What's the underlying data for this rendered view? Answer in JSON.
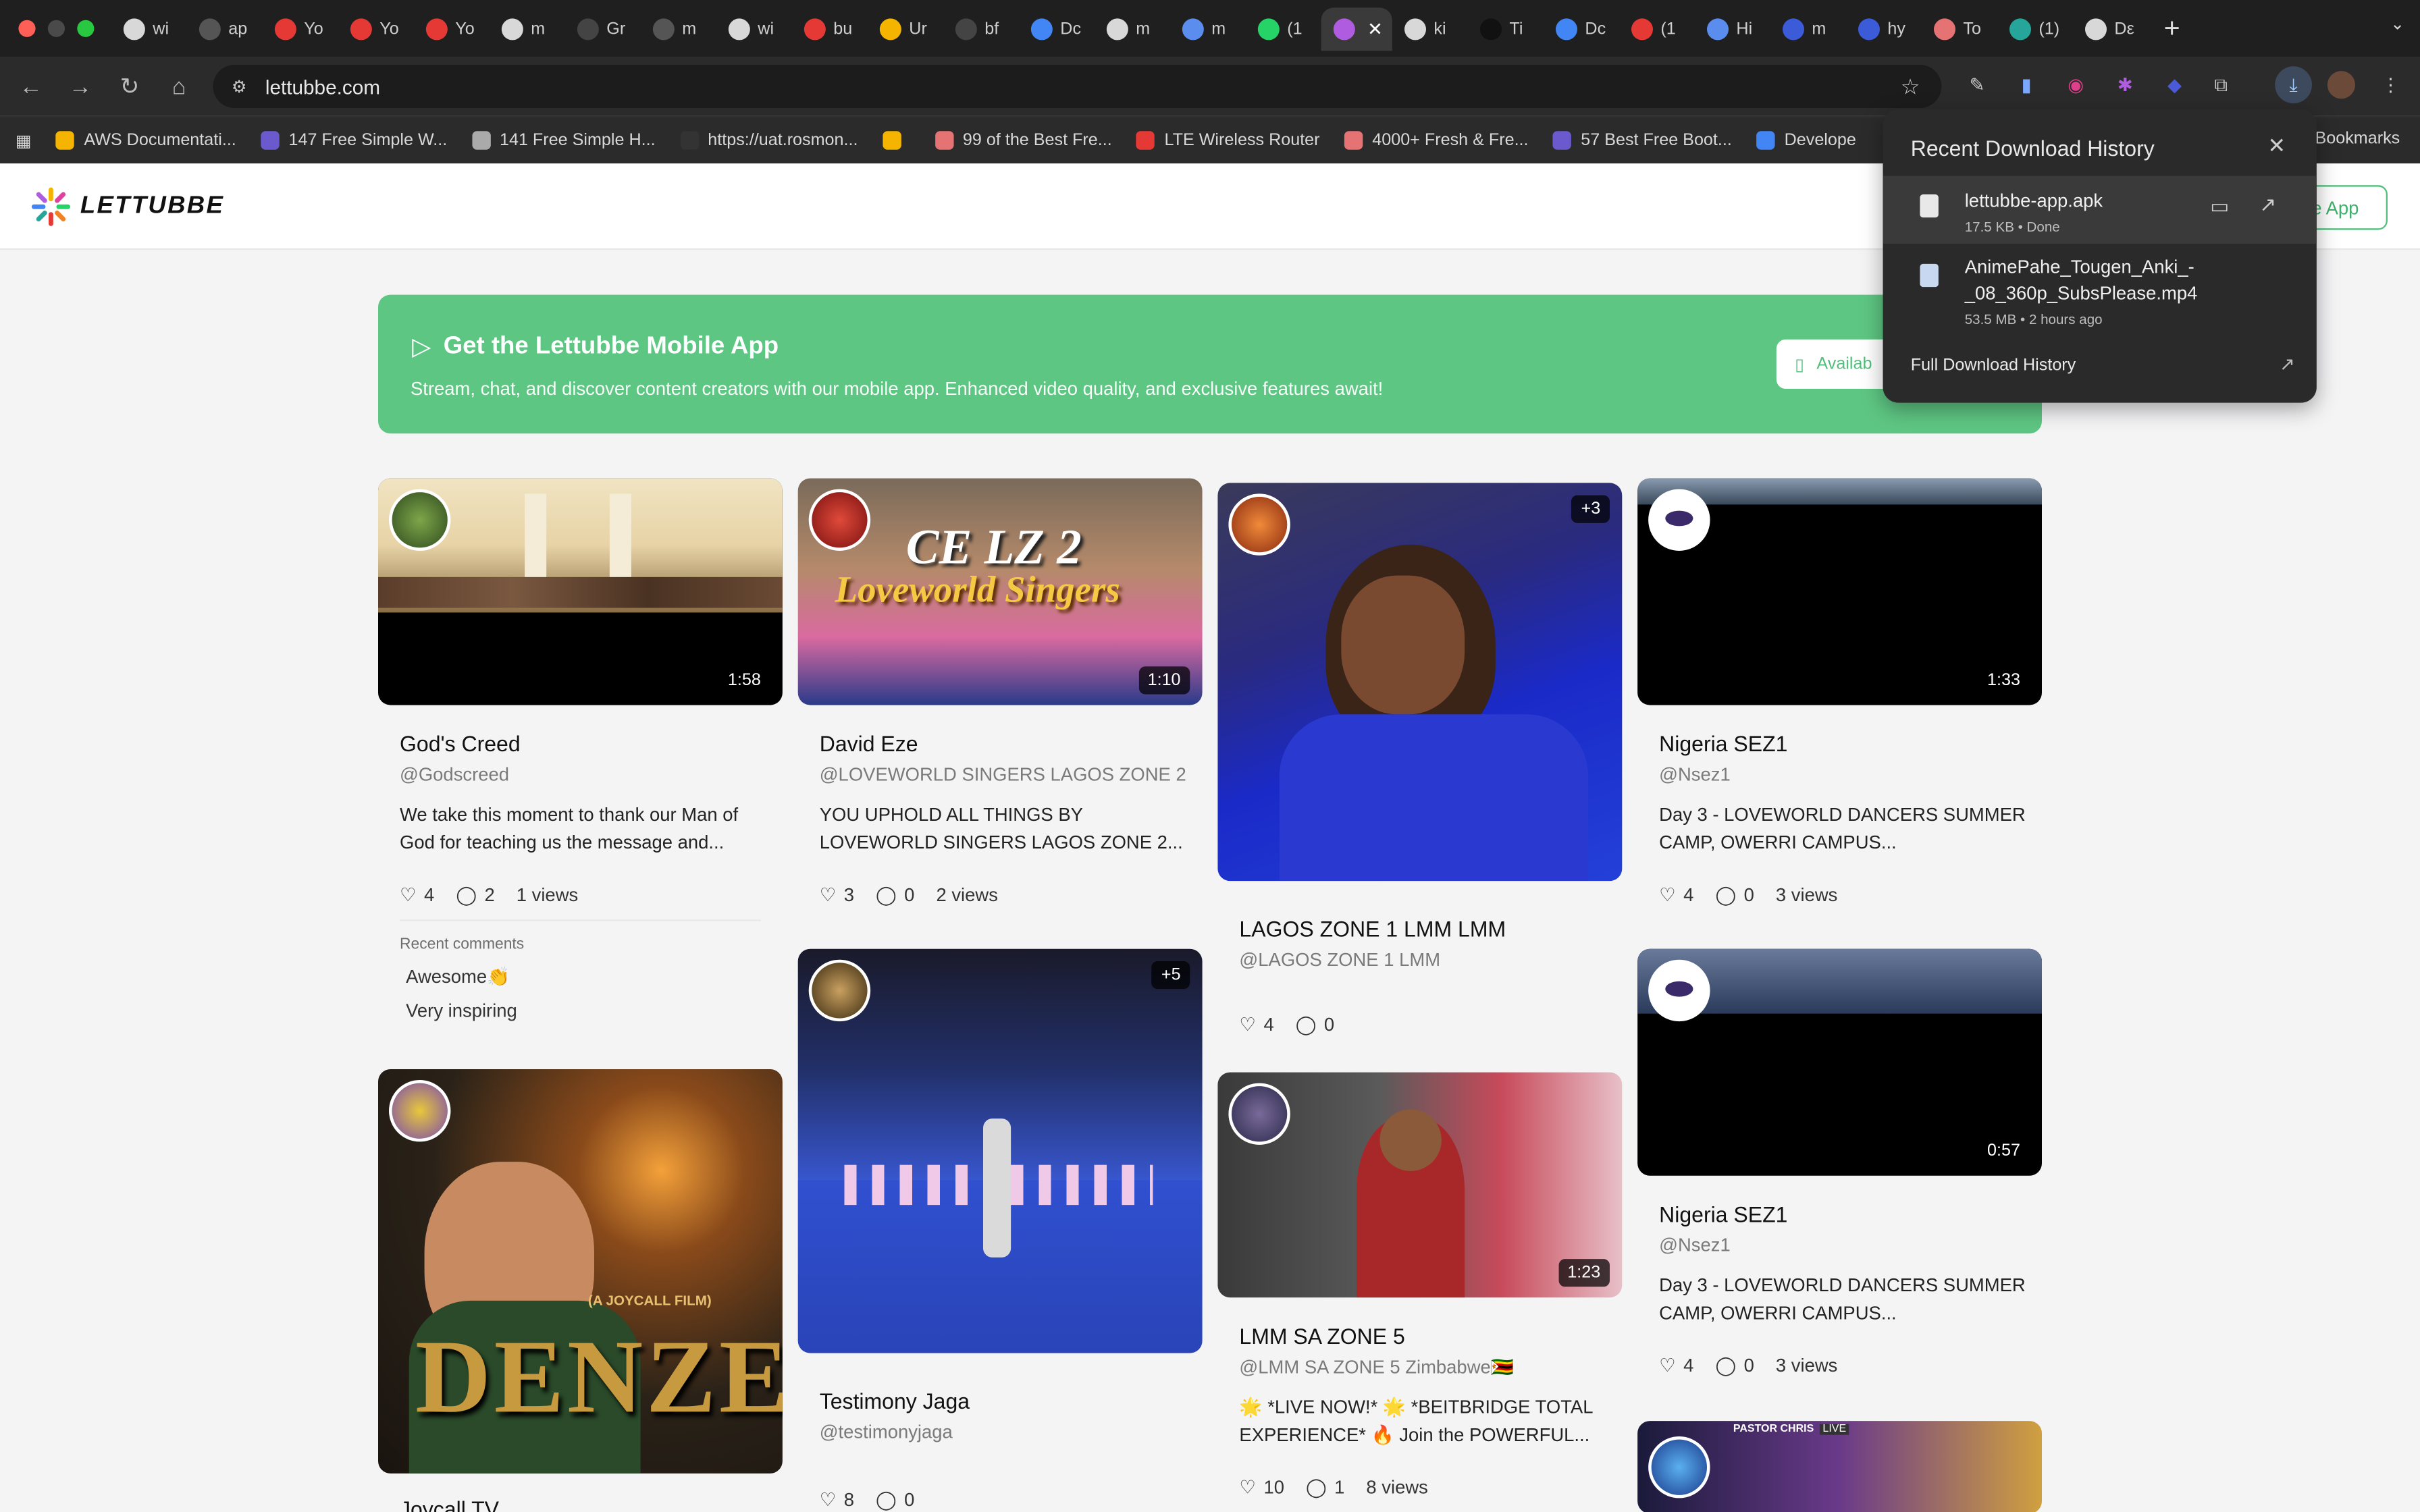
{
  "browser": {
    "tabs": [
      {
        "label": "wi",
        "icon_color": "#d8d8d8"
      },
      {
        "label": "ap",
        "icon_color": "#555"
      },
      {
        "label": "Yo",
        "icon_color": "#e53935"
      },
      {
        "label": "Yo",
        "icon_color": "#e53935"
      },
      {
        "label": "Yo",
        "icon_color": "#e53935"
      },
      {
        "label": "m",
        "icon_color": "#d8d8d8"
      },
      {
        "label": "Gr",
        "icon_color": "#444"
      },
      {
        "label": "m",
        "icon_color": "#555"
      },
      {
        "label": "wi",
        "icon_color": "#d8d8d8"
      },
      {
        "label": "bu",
        "icon_color": "#e53935"
      },
      {
        "label": "Ur",
        "icon_color": "#f4b400"
      },
      {
        "label": "bf",
        "icon_color": "#444"
      },
      {
        "label": "Dc",
        "icon_color": "#4285f4"
      },
      {
        "label": "m",
        "icon_color": "#d8d8d8"
      },
      {
        "label": "m",
        "icon_color": "#5b8def"
      },
      {
        "label": "(1",
        "icon_color": "#25d366"
      },
      {
        "label": "",
        "icon_color": "#b05ce0",
        "active": true
      },
      {
        "label": "ki",
        "icon_color": "#d8d8d8"
      },
      {
        "label": "Ti",
        "icon_color": "#111"
      },
      {
        "label": "Dc",
        "icon_color": "#4285f4"
      },
      {
        "label": "(1",
        "icon_color": "#e53935"
      },
      {
        "label": "Hi",
        "icon_color": "#5b8def"
      },
      {
        "label": "m",
        "icon_color": "#3b5bd9"
      },
      {
        "label": "hy",
        "icon_color": "#3b5bd9"
      },
      {
        "label": "To",
        "icon_color": "#e57373"
      },
      {
        "label": "(1)",
        "icon_color": "#26a69a"
      },
      {
        "label": "Dε",
        "icon_color": "#d8d8d8"
      }
    ],
    "url": "lettubbe.com",
    "bookmarks": [
      {
        "label": "AWS Documentati...",
        "color": "#f4b400"
      },
      {
        "label": "147 Free Simple W...",
        "color": "#6a5acd"
      },
      {
        "label": "141 Free Simple H...",
        "color": "#aaa"
      },
      {
        "label": "https://uat.rosmon...",
        "color": "#333"
      },
      {
        "label": "",
        "color": "#f4b400"
      },
      {
        "label": "99 of the Best Fre...",
        "color": "#e57373"
      },
      {
        "label": "LTE Wireless Router",
        "color": "#e53935"
      },
      {
        "label": "4000+ Fresh & Fre...",
        "color": "#e57373"
      },
      {
        "label": "57 Best Free Boot...",
        "color": "#6a5acd"
      },
      {
        "label": "Develope",
        "color": "#4285f4"
      }
    ],
    "bookmarks_right": "Bookmarks"
  },
  "site": {
    "brand": "LETTUBBE",
    "header_button": "le App",
    "banner": {
      "title": "Get the Lettubbe Mobile App",
      "subtitle": "Stream, chat, and discover content creators with our mobile app. Enhanced video quality, and exclusive features await!",
      "button": "Availab"
    }
  },
  "cards": [
    {
      "title": "God's Creed",
      "handle": "@Godscreed",
      "desc": "We take this moment to thank our Man of God for teaching us the message and...",
      "likes": "4",
      "comments": "2",
      "views": "1 views",
      "duration": "1:58",
      "recent_label": "Recent comments",
      "recent": [
        "Awesome👏",
        "Very inspiring"
      ]
    },
    {
      "title": "David Eze",
      "handle": "@LOVEWORLD SINGERS LAGOS ZONE 2",
      "desc": "YOU UPHOLD ALL THINGS BY LOVEWORLD SINGERS LAGOS ZONE 2...",
      "likes": "3",
      "comments": "0",
      "views": "2 views",
      "duration": "1:10",
      "thumb_text1": "CE LZ 2",
      "thumb_text2": "Loveworld Singers"
    },
    {
      "title": "LAGOS ZONE 1 LMM LMM",
      "handle": "@LAGOS ZONE 1 LMM",
      "likes": "4",
      "comments": "0",
      "badge": "+3"
    },
    {
      "title": "Nigeria SEZ1",
      "handle": "@Nsez1",
      "desc": "Day 3 - LOVEWORLD DANCERS SUMMER CAMP, OWERRI CAMPUS...",
      "likes": "4",
      "comments": "0",
      "views": "3 views",
      "duration": "1:33"
    },
    {
      "title": "Testimony Jaga",
      "handle": "@testimonyjaga",
      "likes": "8",
      "comments": "0",
      "badge": "+5"
    },
    {
      "title": "LMM SA ZONE 5",
      "handle": "@LMM SA ZONE 5 Zimbabwe🇿🇼",
      "desc": "🌟 *LIVE NOW!* 🌟 *BEITBRIDGE TOTAL EXPERIENCE* 🔥 Join the POWERFUL...",
      "likes": "10",
      "comments": "1",
      "views": "8 views",
      "duration": "1:23"
    },
    {
      "title": "Nigeria SEZ1",
      "handle": "@Nsez1",
      "desc": "Day 3 - LOVEWORLD DANCERS SUMMER CAMP, OWERRI CAMPUS...",
      "likes": "4",
      "comments": "0",
      "views": "3 views",
      "duration": "0:57"
    },
    {
      "title": "Joycall TV",
      "thumb_text1": "(A JOYCALL FILM)",
      "thumb_text2": "DENZEL"
    },
    {
      "thumb_text1": "PASTOR CHRIS",
      "thumb_text2": "LIVE"
    }
  ],
  "downloads": {
    "title": "Recent Download History",
    "items": [
      {
        "name": "lettubbe-app.apk",
        "meta": "17.5 KB • Done"
      },
      {
        "name": "AnimePahe_Tougen_Anki_-",
        "name2": "_08_360p_SubsPlease.mp4",
        "meta": "53.5 MB • 2 hours ago"
      }
    ],
    "full": "Full Download History"
  },
  "colors": {
    "accent": "#5ec683",
    "browser_bg": "#2b2b2b"
  }
}
